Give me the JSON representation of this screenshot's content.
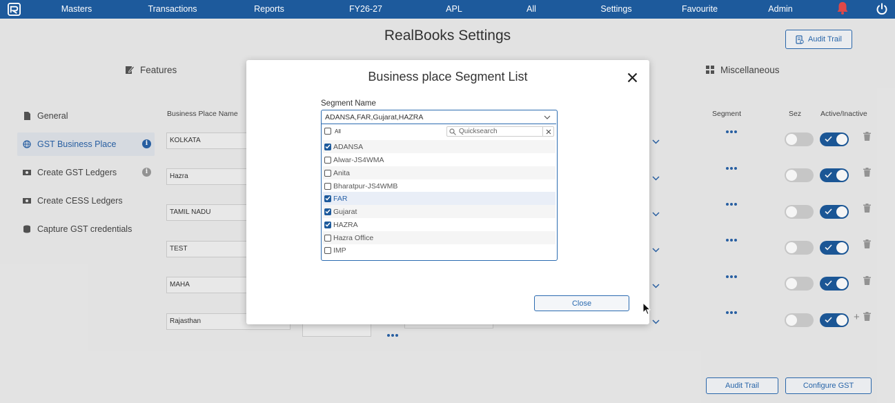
{
  "topnav": {
    "items": [
      "Masters",
      "Transactions",
      "Reports",
      "FY26-27",
      "APL",
      "All",
      "Settings",
      "Favourite",
      "Admin"
    ]
  },
  "page": {
    "title": "RealBooks Settings",
    "audit_trail_top": "Audit Trail",
    "tabs": [
      "Features",
      "Miscellaneous"
    ],
    "sidebar": [
      {
        "label": "General"
      },
      {
        "label": "GST Business Place"
      },
      {
        "label": "Create GST Ledgers"
      },
      {
        "label": "Create CESS Ledgers"
      },
      {
        "label": "Capture GST credentials"
      }
    ],
    "columns": {
      "business_place_name": "Business Place Name",
      "segment": "Segment",
      "sez": "Sez",
      "active": "Active/Inactive"
    },
    "rows": [
      "KOLKATA",
      "Hazra",
      "TAMIL NADU",
      "TEST",
      "MAHA",
      "Rajasthan"
    ],
    "audit_trail_bottom": "Audit Trail",
    "configure_gst": "Configure GST"
  },
  "modal": {
    "title": "Business place Segment List",
    "segment_label": "Segment Name",
    "selected_value": "ADANSA,FAR,Gujarat,HAZRA",
    "all_label": "All",
    "quicksearch_placeholder": "Quicksearch",
    "options": [
      {
        "label": "ADANSA",
        "checked": true
      },
      {
        "label": "Alwar-JS4WMA",
        "checked": false
      },
      {
        "label": "Anita",
        "checked": false
      },
      {
        "label": "Bharatpur-JS4WMB",
        "checked": false
      },
      {
        "label": "FAR",
        "checked": true
      },
      {
        "label": "Gujarat",
        "checked": true
      },
      {
        "label": "HAZRA",
        "checked": true
      },
      {
        "label": "Hazra Office",
        "checked": false
      },
      {
        "label": "IMP",
        "checked": false
      }
    ],
    "close_label": "Close"
  },
  "colors": {
    "nav_bg": "#1d5a9c",
    "accent": "#2a63a8",
    "bell": "#e04848"
  }
}
